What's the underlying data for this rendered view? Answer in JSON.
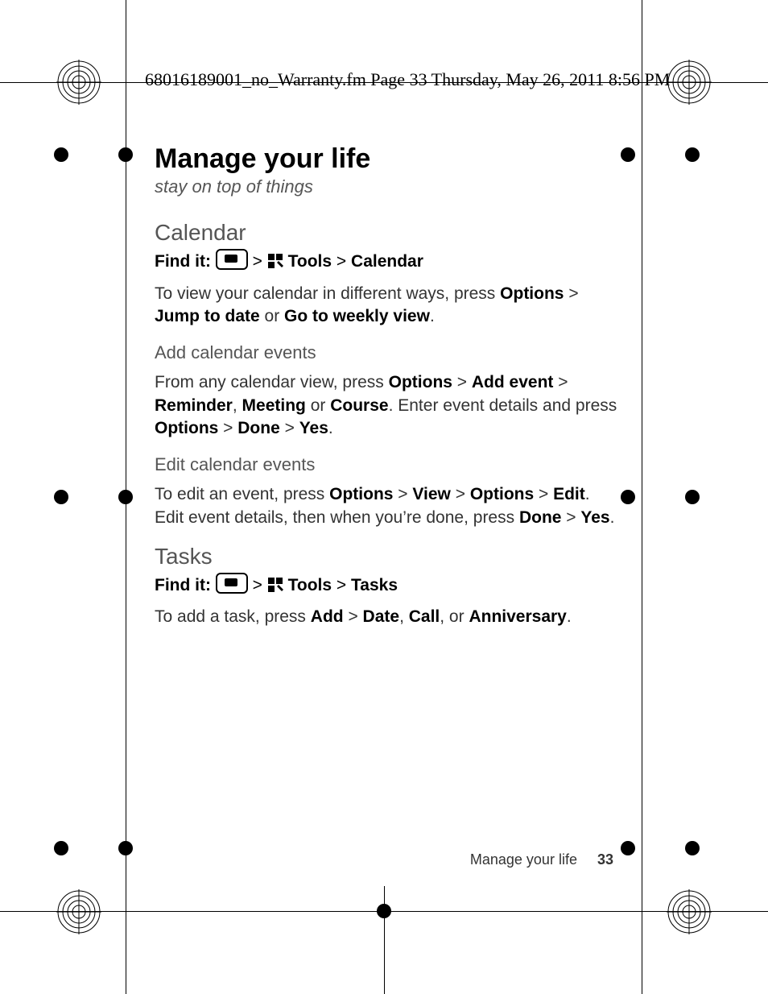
{
  "header": "68016189001_no_Warranty.fm  Page 33  Thursday, May 26, 2011  8:56 PM",
  "title": "Manage your life",
  "subtitle": "stay on top of things",
  "calendar": {
    "heading": "Calendar",
    "findit_label": "Find it:",
    "gt": ">",
    "tools": "Tools",
    "calendar": "Calendar",
    "intro_pre": "To view your calendar in different ways, press ",
    "options": "Options",
    "intro_gt": " > ",
    "jump": "Jump to date",
    "or": " or ",
    "weekly": "Go to weekly view",
    "period": ".",
    "add": {
      "heading": "Add calendar events",
      "pre": "From any calendar view, press ",
      "options": "Options",
      "gt1": " > ",
      "addevent": "Add event",
      "gt2": " > ",
      "reminder": "Reminder",
      "c1": ", ",
      "meeting": "Meeting",
      "or": " or ",
      "course": "Course",
      "mid": ". Enter event details and press ",
      "options2": "Options",
      "gt3": " > ",
      "done": "Done",
      "gt4": " > ",
      "yes": "Yes",
      "period": "."
    },
    "edit": {
      "heading": "Edit calendar events",
      "pre": "To edit an event, press ",
      "options": "Options",
      "gt1": " > ",
      "view": "View",
      "gt2": " > ",
      "options2": "Options",
      "gt3": " > ",
      "editlabel": "Edit",
      "mid": ". Edit event details, then when you’re done, press ",
      "done": "Done",
      "gt4": " > ",
      "yes": "Yes",
      "period": "."
    }
  },
  "tasks": {
    "heading": "Tasks",
    "findit_label": "Find it:",
    "gt": ">",
    "tools": "Tools",
    "tasks": "Tasks",
    "intro_pre": "To add a task, press ",
    "add": "Add",
    "gt1": " > ",
    "date": "Date",
    "c1": ", ",
    "call": "Call",
    "c2": ", or ",
    "anniv": "Anniversary",
    "period": "."
  },
  "footer": {
    "text": "Manage your life",
    "page": "33"
  }
}
